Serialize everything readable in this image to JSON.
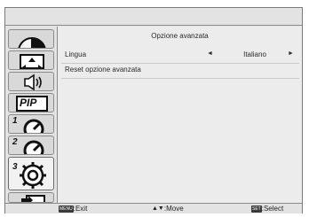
{
  "menu": {
    "title": "Opzione avanzata",
    "items": [
      {
        "label": "Lingua",
        "value": "Italiano",
        "left_arrow": "◄",
        "right_arrow": "►"
      },
      {
        "label": "Reset opzione avanzata"
      }
    ]
  },
  "sidebar": {
    "tabs": [
      {
        "icon": "picture-icon"
      },
      {
        "icon": "screen-icon"
      },
      {
        "icon": "audio-icon"
      },
      {
        "icon": "pip-icon",
        "label": "PIP"
      },
      {
        "icon": "config1-icon",
        "number": "1"
      },
      {
        "icon": "config2-icon",
        "number": "2"
      },
      {
        "icon": "advanced-option-icon",
        "number": "3",
        "selected": true
      },
      {
        "icon": "input-icon"
      }
    ]
  },
  "footer": {
    "exit_key": "MENU",
    "exit_label": ":Exit",
    "move_key": "▲▼",
    "move_label": ":Move",
    "select_key": "SET",
    "select_label": ":Select"
  }
}
